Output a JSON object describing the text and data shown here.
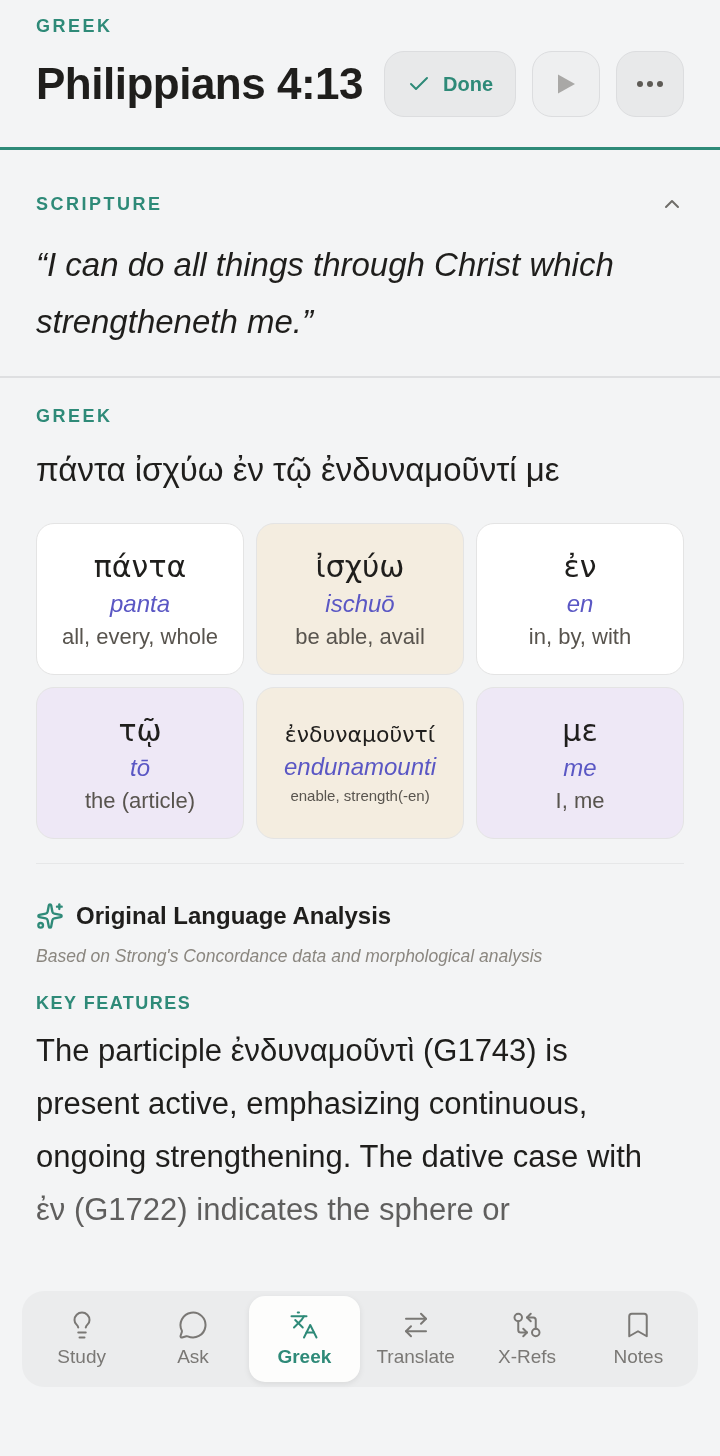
{
  "header": {
    "eyebrow": "GREEK",
    "title": "Philippians 4:13",
    "done_button": {
      "label": "Done",
      "checked": true
    },
    "play_button": {
      "disabled": true
    }
  },
  "scripture": {
    "heading": "SCRIPTURE",
    "expanded": true,
    "text": "“I can do all things through Christ which strengtheneth me.”"
  },
  "greek": {
    "heading": "GREEK",
    "text": "πάντα ἰσχύω ἐν τῷ ἐνδυναμοῦντί με",
    "words": [
      {
        "greek": "πάντα",
        "translit": "panta",
        "gloss": "all, every, whole",
        "color": "#ffffff"
      },
      {
        "greek": "ἰσχύω",
        "translit": "ischuō",
        "gloss": "be able, avail",
        "color": "#f4ede0"
      },
      {
        "greek": "ἐν",
        "translit": "en",
        "gloss": "in, by, with",
        "color": "#ffffff"
      },
      {
        "greek": "τῷ",
        "translit": "tō",
        "gloss": "the (article)",
        "color": "#eee8f6"
      },
      {
        "greek": "ἐνδυναμοῦντί",
        "translit": "endunamounti",
        "gloss": "enable, strength(-en)",
        "color": "#f4ede0"
      },
      {
        "greek": "με",
        "translit": "me",
        "gloss": "I, me",
        "color": "#eee8f6"
      }
    ]
  },
  "analysis": {
    "title": "Original Language Analysis",
    "subtitle": "Based on Strong's Concordance data and morphological analysis",
    "key_features_heading": "KEY FEATURES",
    "lines": [
      "The participle ἐνδυναμοῦντὶ (G1743) is",
      "present active, emphasizing continuous,",
      "ongoing strengthening. The dative case with",
      "ἐν (G1722) indicates the sphere or"
    ]
  },
  "tabs": [
    {
      "label": "Study",
      "selected": false
    },
    {
      "label": "Ask",
      "selected": false
    },
    {
      "label": "Greek",
      "selected": true
    },
    {
      "label": "Translate",
      "selected": false
    },
    {
      "label": "X-Refs",
      "selected": false
    },
    {
      "label": "Notes",
      "selected": false
    }
  ]
}
